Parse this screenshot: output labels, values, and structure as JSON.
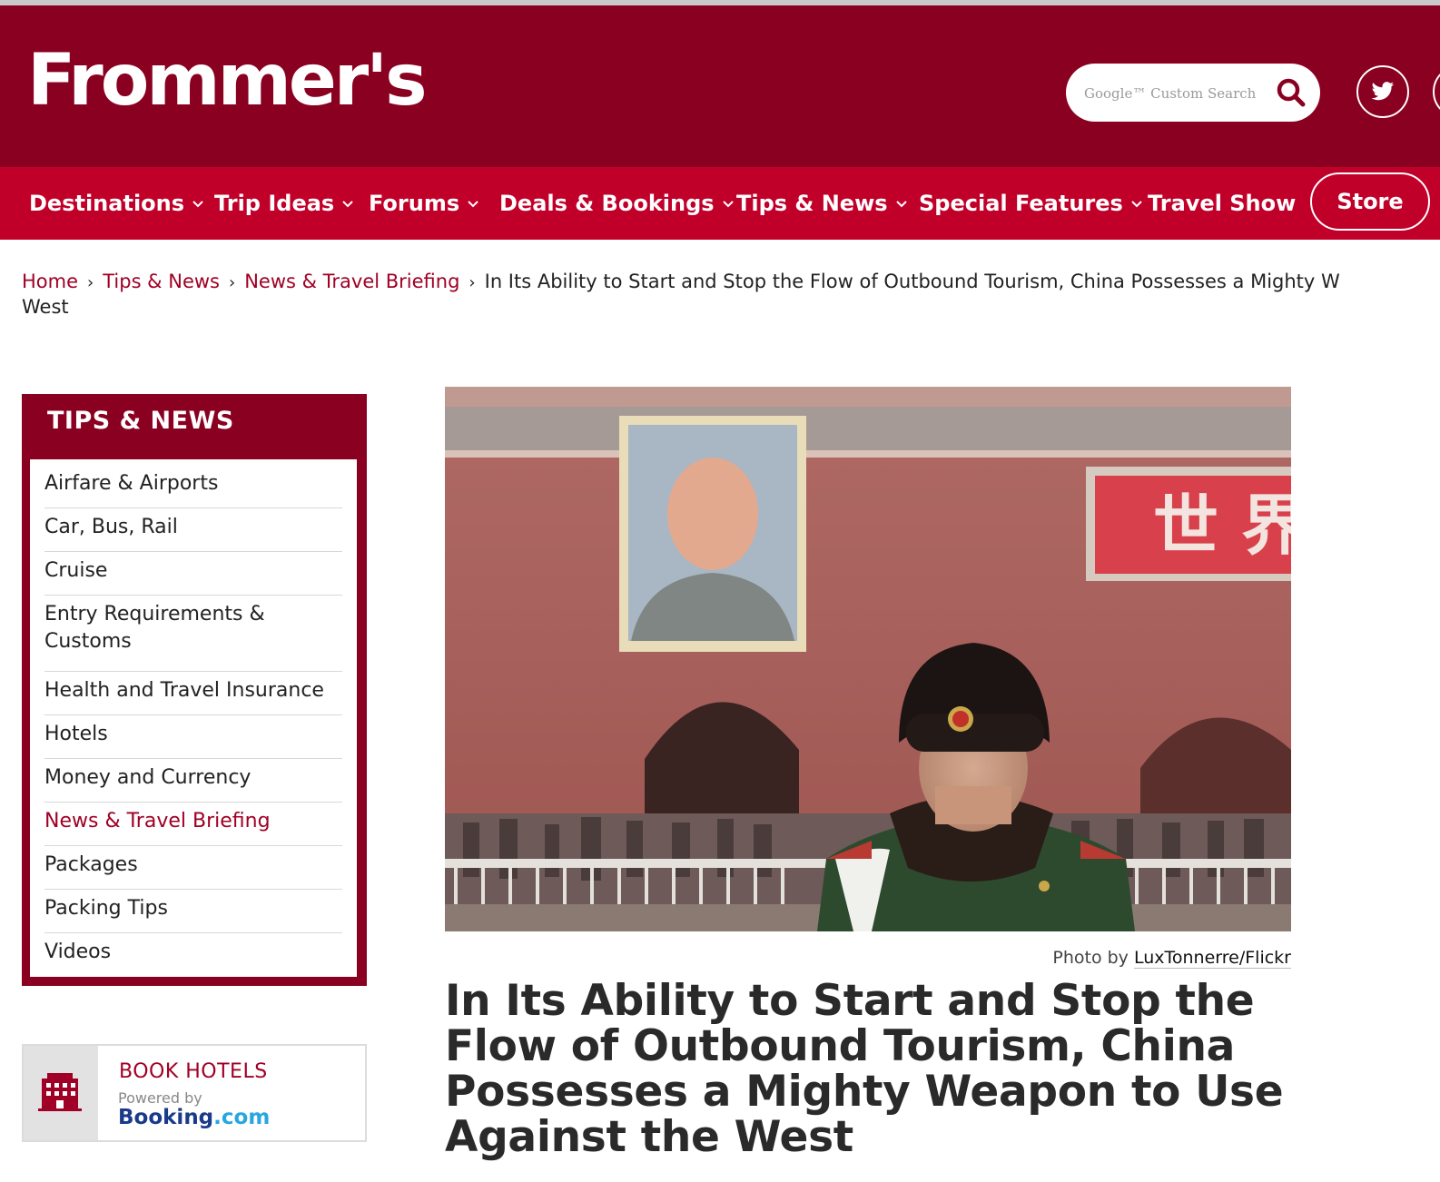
{
  "header": {
    "logo_text": "Frommer's",
    "search_placeholder": "Google™ Custom Search",
    "brand_color": "#8a0020",
    "nav_color": "#c1002a"
  },
  "nav": {
    "items": [
      {
        "label": "Destinations",
        "has_dropdown": true
      },
      {
        "label": "Trip Ideas",
        "has_dropdown": true
      },
      {
        "label": "Forums",
        "has_dropdown": true
      },
      {
        "label": "Deals & Bookings",
        "has_dropdown": true
      },
      {
        "label": "Tips & News",
        "has_dropdown": true
      },
      {
        "label": "Special Features",
        "has_dropdown": true
      },
      {
        "label": "Travel Show",
        "has_dropdown": false
      }
    ],
    "store_label": "Store"
  },
  "breadcrumb": {
    "items": [
      "Home",
      "Tips & News",
      "News & Travel Briefing"
    ],
    "current": "In Its Ability to Start and Stop the Flow of Outbound Tourism, China Possesses a Mighty W",
    "current_line2": "West",
    "separator": "›"
  },
  "sidebar": {
    "title": "TIPS & NEWS",
    "items": [
      {
        "label": "Airfare & Airports"
      },
      {
        "label": "Car, Bus, Rail"
      },
      {
        "label": "Cruise"
      },
      {
        "label": "Entry Requirements & Customs"
      },
      {
        "label": "Health and Travel Insurance"
      },
      {
        "label": "Hotels"
      },
      {
        "label": "Money and Currency"
      },
      {
        "label": "News & Travel Briefing",
        "active": true
      },
      {
        "label": "Packages"
      },
      {
        "label": "Packing Tips"
      },
      {
        "label": "Videos"
      }
    ]
  },
  "booking": {
    "title": "BOOK HOTELS",
    "powered": "Powered by",
    "brand_main": "Booking",
    "brand_suffix": ".com"
  },
  "article": {
    "photo_credit_prefix": "Photo by",
    "photo_credit_link": "LuxTonnerre/Flickr",
    "headline": "In Its Ability to Start and Stop the Flow of Outbound Tourism, China Possesses a Mighty Weapon to Use Against the West",
    "sign_text": "世 界"
  }
}
